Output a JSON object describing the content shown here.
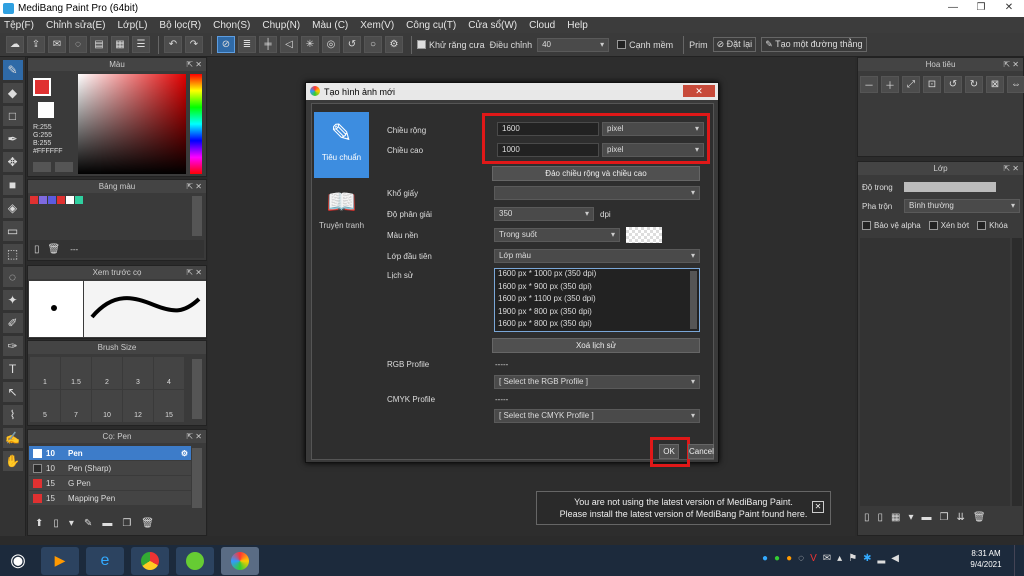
{
  "window": {
    "title": "MediBang Paint Pro (64bit)"
  },
  "menu": [
    "Tệp(F)",
    "Chỉnh sửa(E)",
    "Lớp(L)",
    "Bộ lọc(R)",
    "Chọn(S)",
    "Chụp(N)",
    "Màu (C)",
    "Xem(V)",
    "Công cụ(T)",
    "Cửa sổ(W)",
    "Cloud",
    "Help"
  ],
  "toolbar": {
    "antialias": "Khử răng cưa",
    "adjust": "Điều chỉnh",
    "adjust_value": "40",
    "snap": "Cạnh mềm",
    "prim": "Prim",
    "reset": "Đặt lại",
    "create_line": "Tạo một đường thẳng"
  },
  "color_panel": {
    "title": "Màu",
    "r": "R:255",
    "g": "G:255",
    "b": "B:255",
    "hex": "#FFFFFF"
  },
  "palette_panel": {
    "title": "Bảng màu",
    "name": "---",
    "swatches": [
      "#e03131",
      "#7f6ae0",
      "#5b5be0",
      "#e03131",
      "#ffffff",
      "#2fd0a0"
    ]
  },
  "preview_panel": {
    "title": "Xem trước cọ"
  },
  "brushsize_panel": {
    "title": "Brush Size",
    "sizes": [
      "1",
      "1.5",
      "2",
      "3",
      "4",
      "5",
      "7",
      "10",
      "12",
      "15"
    ]
  },
  "brush_panel": {
    "title": "Cọ: Pen",
    "items": [
      {
        "size": "10",
        "name": "Pen",
        "color": "#ffffff"
      },
      {
        "size": "10",
        "name": "Pen (Sharp)",
        "color": "#2a2a2a"
      },
      {
        "size": "15",
        "name": "G Pen",
        "color": "#e03131"
      },
      {
        "size": "15",
        "name": "Mapping Pen",
        "color": "#e03131"
      }
    ]
  },
  "navigator_panel": {
    "title": "Hoa tiêu"
  },
  "layer_panel": {
    "title": "Lớp",
    "opacity_label": "Độ trong",
    "blend_label": "Pha trộn",
    "blend_value": "Bình thường",
    "protect_alpha": "Bảo vệ alpha",
    "clipping": "Xén bớt",
    "lock": "Khóa"
  },
  "dialog": {
    "title": "Tạo hình ảnh mới",
    "close": "✕",
    "tabs": [
      "Tiêu chuẩn",
      "Truyện tranh"
    ],
    "width_label": "Chiều rộng",
    "width_value": "1600",
    "width_unit": "pixel",
    "height_label": "Chiều cao",
    "height_value": "1000",
    "height_unit": "pixel",
    "swap_button": "Đảo chiều rộng và chiều cao",
    "paper_label": "Khổ giấy",
    "paper_value": "",
    "resolution_label": "Độ phân giải",
    "resolution_value": "350",
    "resolution_unit": "dpi",
    "background_label": "Màu nền",
    "background_value": "Trong suốt",
    "firstlayer_label": "Lớp đầu tiên",
    "firstlayer_value": "Lớp màu",
    "history_label": "Lịch sử",
    "history": [
      "1600 px * 1000 px (350 dpi)",
      "1600 px * 900 px (350 dpi)",
      "1600 px * 1100 px (350 dpi)",
      "1900 px * 800 px (350 dpi)",
      "1600 px * 800 px (350 dpi)"
    ],
    "clear_history": "Xoá lịch sử",
    "rgb_label": "RGB Profile",
    "rgb_value": "-----",
    "rgb_select": "[ Select the RGB Profile ]",
    "cmyk_label": "CMYK Profile",
    "cmyk_value": "-----",
    "cmyk_select": "[ Select the CMYK Profile ]",
    "ok": "OK",
    "cancel": "Cancel"
  },
  "notice": {
    "line1": "You are not using the latest version of MediBang Paint.",
    "line2": "Please install the latest version of MediBang Paint found here.",
    "close": "✕"
  },
  "taskbar": {
    "time": "8:31 AM",
    "date": "9/4/2021"
  }
}
